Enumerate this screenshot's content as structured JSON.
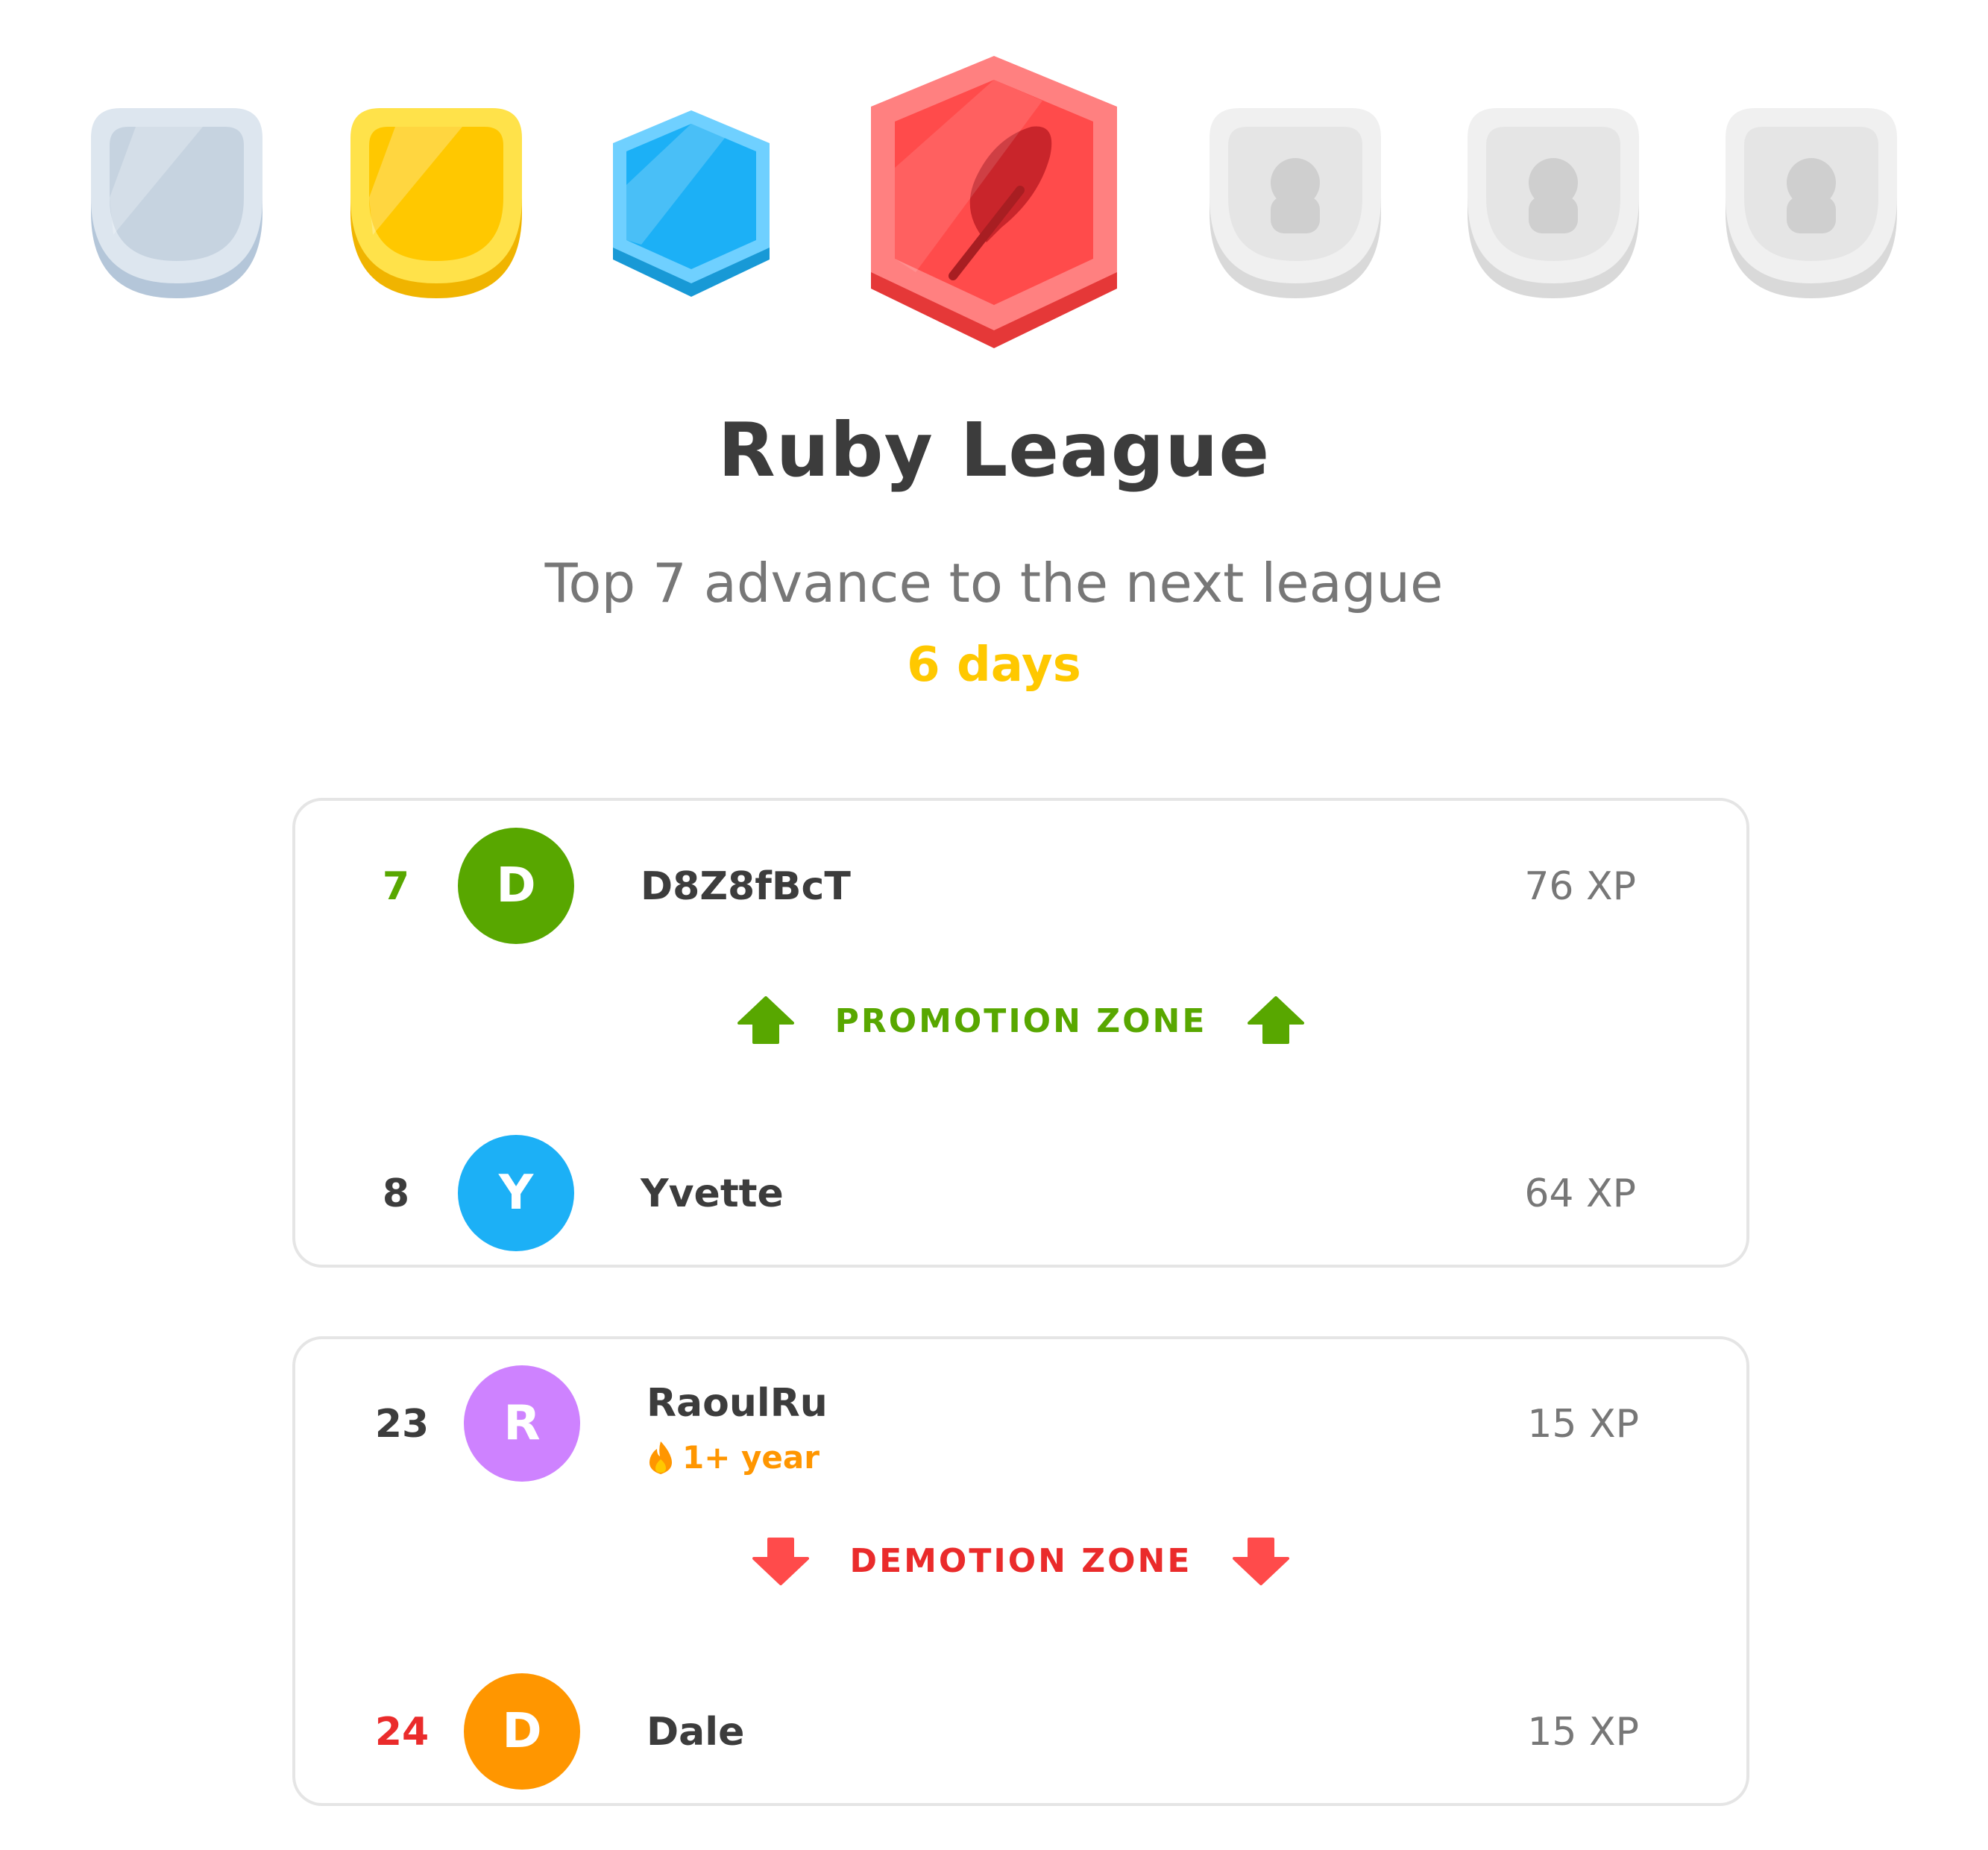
{
  "league": {
    "title": "Ruby League",
    "subtitle": "Top 7 advance to the next league",
    "countdown": "6 days"
  },
  "badges": [
    {
      "name": "bronze-league-badge",
      "state": "unlocked",
      "color": "#cfdbe6"
    },
    {
      "name": "gold-league-badge",
      "state": "unlocked",
      "color": "#ffc800"
    },
    {
      "name": "sapphire-league-badge",
      "state": "unlocked",
      "color": "#1cb0f6"
    },
    {
      "name": "ruby-league-badge",
      "state": "current",
      "color": "#ff4b4b"
    },
    {
      "name": "locked-league-badge",
      "state": "locked",
      "color": "#e5e5e5"
    },
    {
      "name": "locked-league-badge",
      "state": "locked",
      "color": "#e5e5e5"
    },
    {
      "name": "locked-league-badge",
      "state": "locked",
      "color": "#e5e5e5"
    }
  ],
  "promotion_card": {
    "rows": [
      {
        "rank": "7",
        "initial": "D",
        "name": "D8Z8fBcT",
        "xp": "76 XP",
        "avatar_color": "#58a700"
      },
      {
        "rank": "8",
        "initial": "Y",
        "name": "Yvette",
        "xp": "64 XP",
        "avatar_color": "#1cb0f6"
      }
    ],
    "zone_label": "PROMOTION ZONE",
    "zone_color": "#58a700"
  },
  "demotion_card": {
    "rows": [
      {
        "rank": "23",
        "initial": "R",
        "name": "RaoulRu",
        "streak": "1+ year",
        "xp": "15 XP",
        "avatar_color": "#ce82ff"
      },
      {
        "rank": "24",
        "initial": "D",
        "name": "Dale",
        "xp": "15 XP",
        "avatar_color": "#ff9600"
      }
    ],
    "zone_label": "DEMOTION ZONE",
    "zone_color": "#ea2b2b"
  }
}
